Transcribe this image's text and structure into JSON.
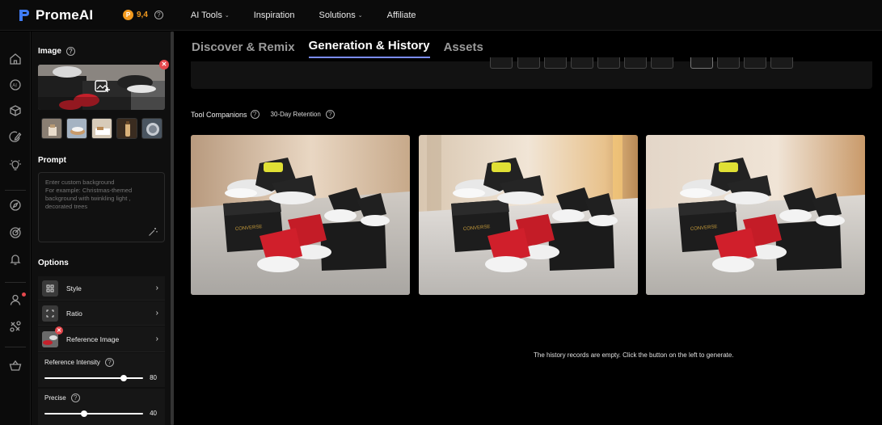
{
  "app": {
    "name": "PromeAI"
  },
  "credits": {
    "value": "9,4"
  },
  "nav": [
    {
      "label": "AI Tools",
      "has_dropdown": true
    },
    {
      "label": "Inspiration",
      "has_dropdown": false
    },
    {
      "label": "Solutions",
      "has_dropdown": true
    },
    {
      "label": "Affiliate",
      "has_dropdown": false
    }
  ],
  "rail_icons": [
    "home-icon",
    "ai-icon",
    "cube-icon",
    "edit-icon",
    "bulb-icon",
    "compass-icon",
    "target-icon",
    "bell-icon",
    "user-icon",
    "tools-icon",
    "basket-icon"
  ],
  "panel": {
    "image_title": "Image",
    "prompt_title": "Prompt",
    "prompt_placeholder": "Enter custom background\nFor example: Christmas-themed background with twinkling light , decorated trees",
    "options_title": "Options",
    "options": [
      {
        "label": "Style",
        "icon": "grid-icon"
      },
      {
        "label": "Ratio",
        "icon": "ratio-icon"
      },
      {
        "label": "Reference Image",
        "icon": "reference-thumbnail"
      }
    ],
    "reference_intensity": {
      "label": "Reference Intensity",
      "value": 80
    },
    "precise": {
      "label": "Precise",
      "value": 40
    }
  },
  "tabs": [
    {
      "label": "Discover & Remix",
      "active": false
    },
    {
      "label": "Generation & History",
      "active": true
    },
    {
      "label": "Assets",
      "active": false
    }
  ],
  "companions": {
    "label": "Tool Companions",
    "retention": "30-Day Retention"
  },
  "empty_message": "The history records are empty. Click the button on the left to generate.",
  "colors": {
    "accent": "#7b8cff",
    "credits": "#f29a1f",
    "danger": "#e5484d"
  }
}
